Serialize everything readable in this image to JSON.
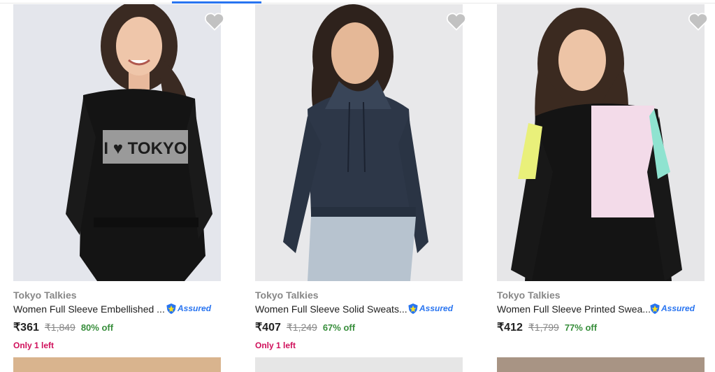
{
  "products": [
    {
      "brand": "Tokyo Talkies",
      "title": "Women Full Sleeve Embellished ...",
      "assured": "Assured",
      "price": "₹361",
      "mrp": "₹1,849",
      "discount": "80% off",
      "stock": "Only 1 left",
      "image_text": "I ♥ TOKYO"
    },
    {
      "brand": "Tokyo Talkies",
      "title": "Women Full Sleeve Solid Sweats...",
      "assured": "Assured",
      "price": "₹407",
      "mrp": "₹1,249",
      "discount": "67% off",
      "stock": "Only 1 left"
    },
    {
      "brand": "Tokyo Talkies",
      "title": "Women Full Sleeve Printed Swea...",
      "assured": "Assured",
      "price": "₹412",
      "mrp": "₹1,799",
      "discount": "77% off"
    }
  ],
  "colors": {
    "accent": "#2874f0",
    "discount": "#388e3c",
    "stock": "#d0105b",
    "brand_text": "#878787"
  },
  "icons": {
    "wishlist": "heart-icon",
    "assured": "shield-icon"
  }
}
